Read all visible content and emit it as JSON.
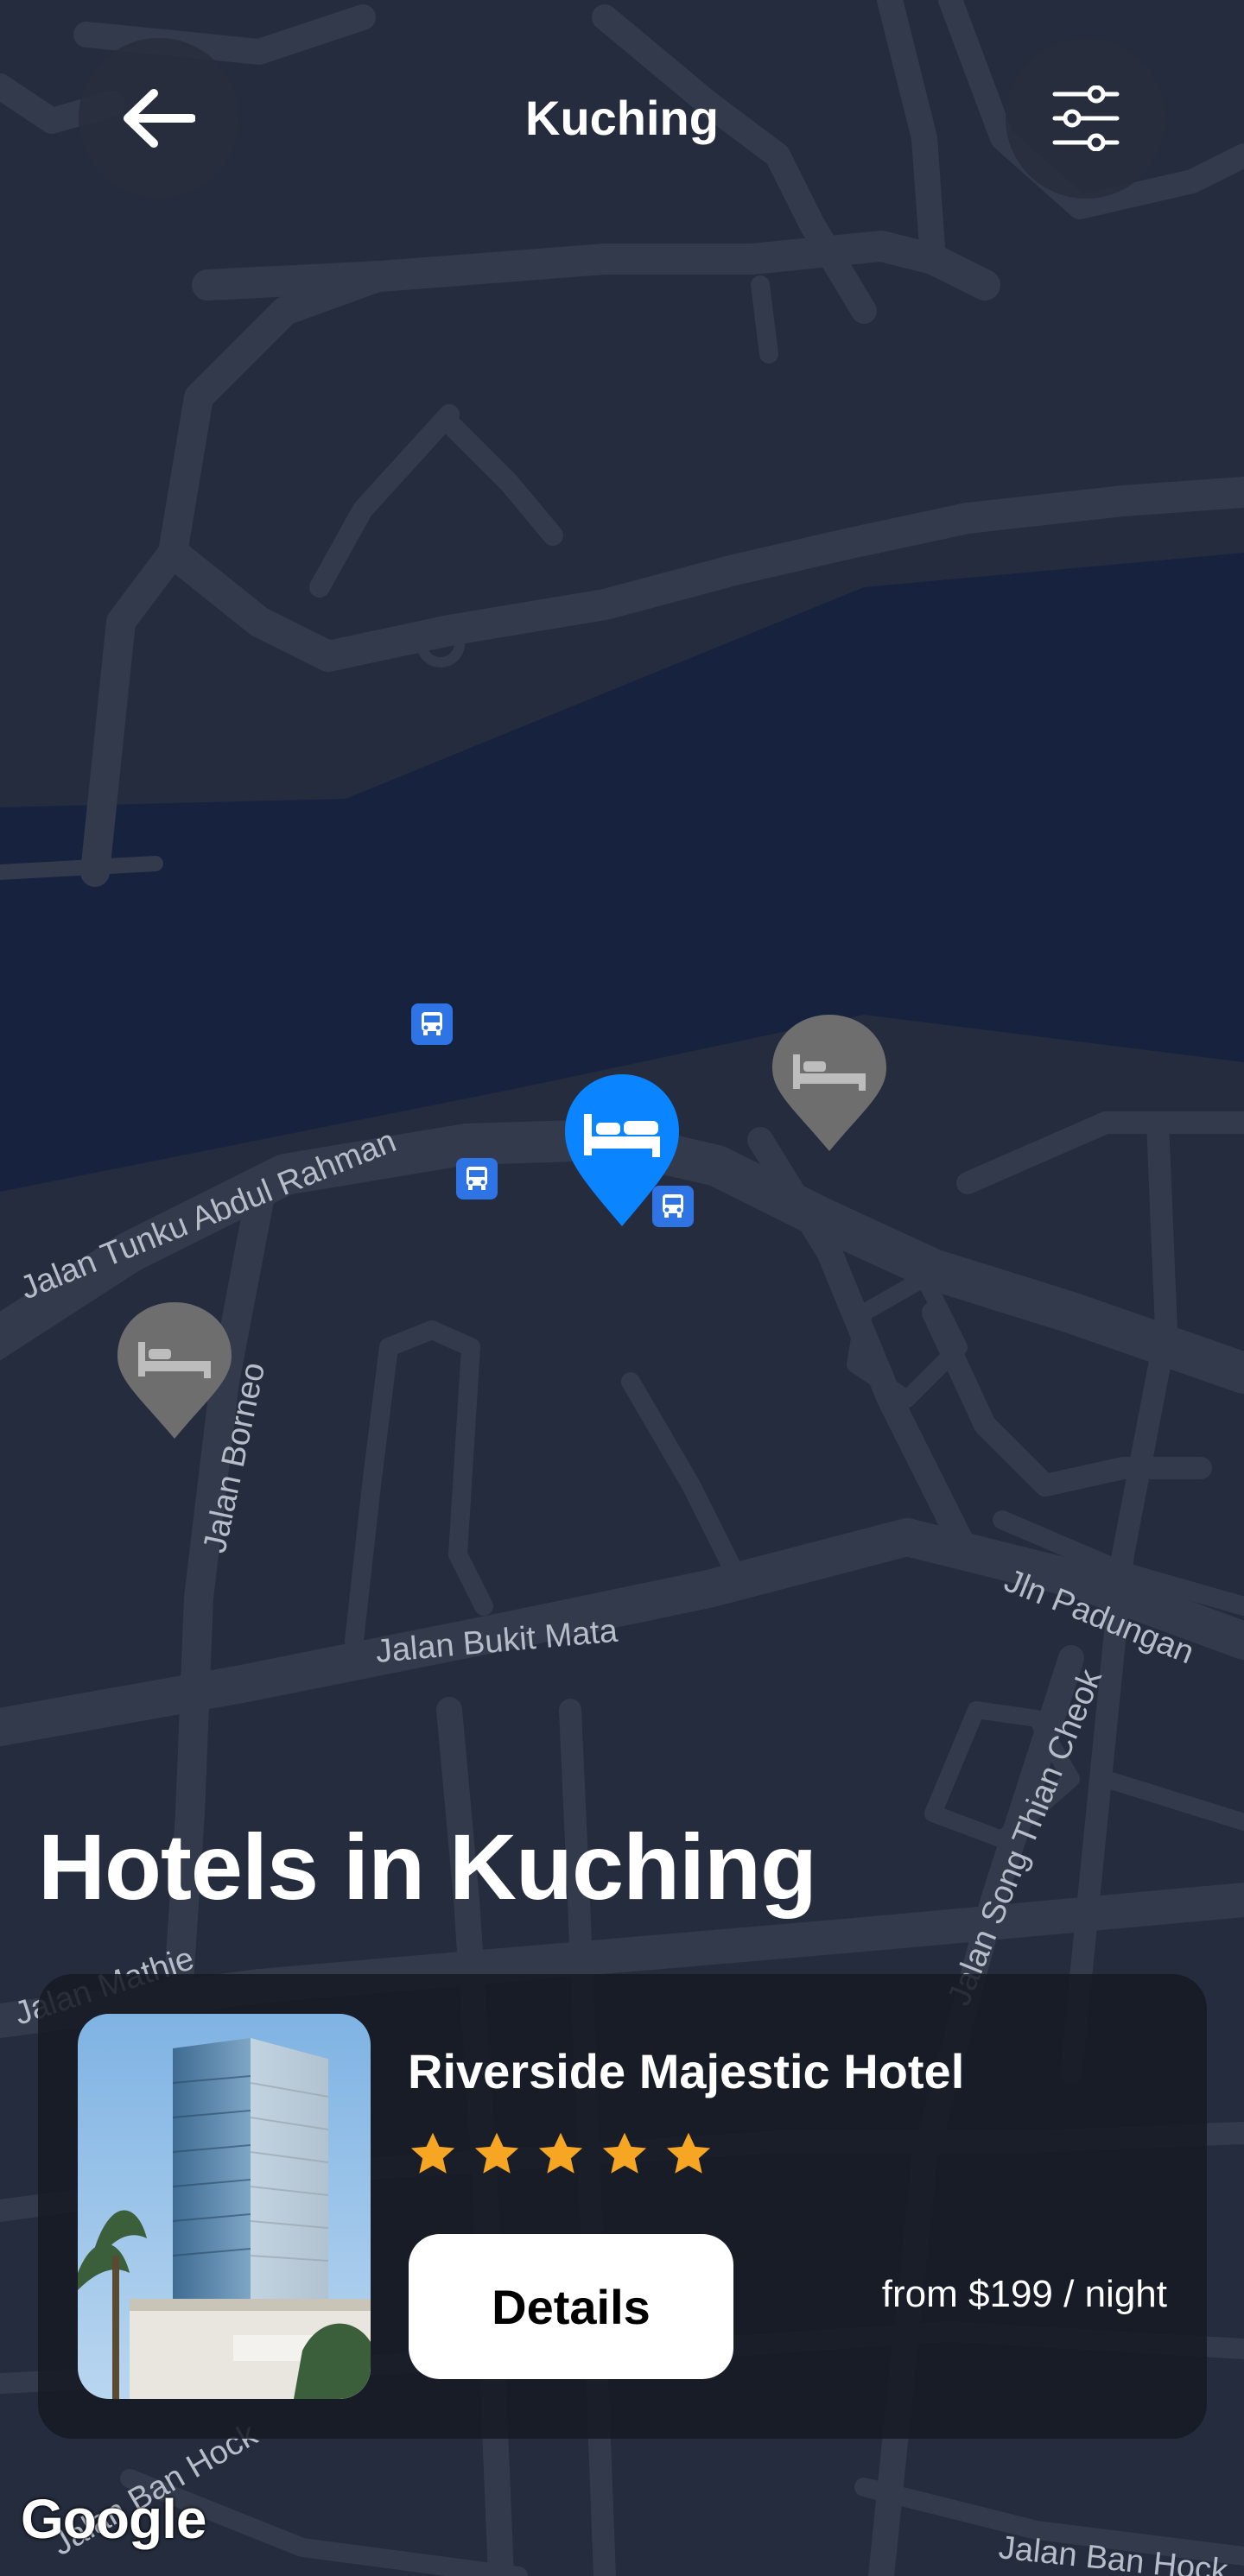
{
  "header": {
    "title": "Kuching",
    "back_icon": "arrow-left-icon",
    "filter_icon": "sliders-icon"
  },
  "map": {
    "road_labels": [
      "Jalan Tunku Abdul Rahman",
      "Jalan Borneo",
      "Jalan Bukit Mata",
      "Jln Padungan",
      "Jalan Song Thian Cheok",
      "Jalan Mathie",
      "Jalan Ban Hock",
      "Jalan Ban Hock"
    ],
    "markers": [
      "hotel-pin-selected",
      "hotel-pin",
      "hotel-pin",
      "bus-stop",
      "bus-stop",
      "bus-stop"
    ],
    "attribution": "Google",
    "colors": {
      "land": "#242c3d",
      "water": "#17223f",
      "road": "#333b4c",
      "selected_pin": "#0a84ff",
      "pin": "#6b6b6b"
    }
  },
  "section": {
    "title": "Hotels in Kuching"
  },
  "hotel": {
    "name": "Riverside Majestic Hotel",
    "rating": 5,
    "details_label": "Details",
    "price": "from $199 / night",
    "star_color": "#f6a623"
  }
}
